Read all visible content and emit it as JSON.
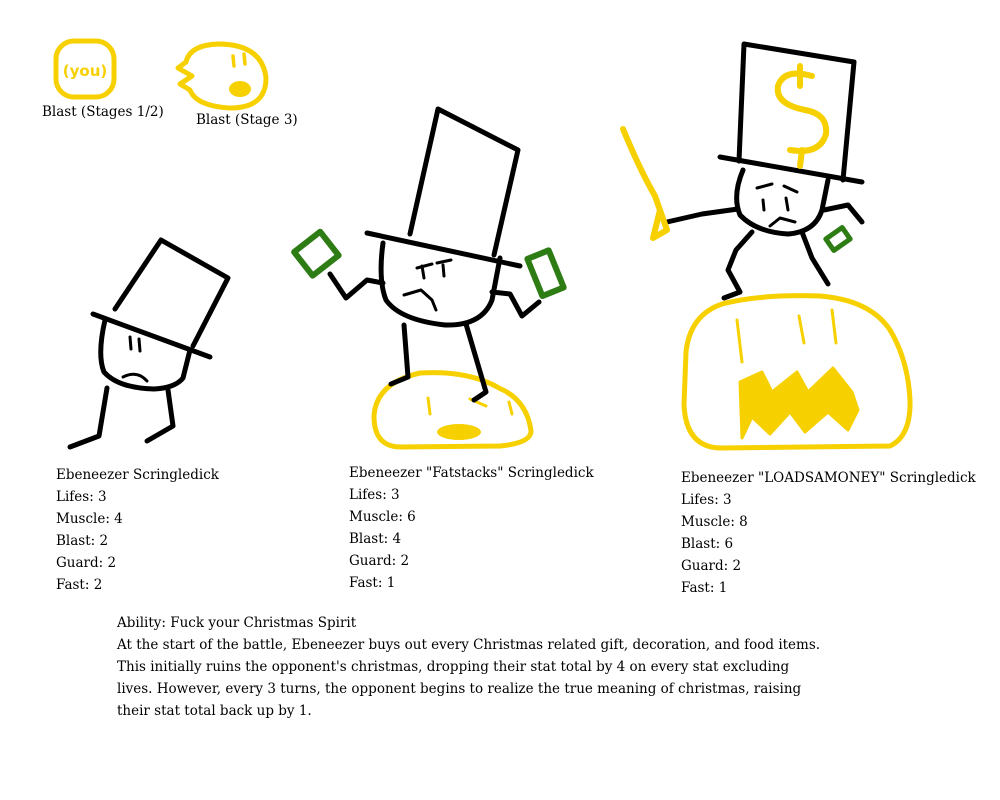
{
  "colors": {
    "ink": "#000000",
    "gold": "#f7d000",
    "cash": "#2e7d14",
    "background": "#ffffff"
  },
  "blast_icons": [
    {
      "icon": "you-blast-icon",
      "glyph": "(you)",
      "label": "Blast (Stages 1/2)"
    },
    {
      "icon": "face-blast-icon",
      "label": "Blast (Stage 3)"
    }
  ],
  "stages": [
    {
      "name": "Ebeneezer Scringledick",
      "stats": [
        "Lifes: 3",
        "Muscle: 4",
        "Blast: 2",
        "Guard: 2",
        "Fast: 2"
      ]
    },
    {
      "name": "Ebeneezer \"Fatstacks\" Scringledick",
      "stats": [
        "Lifes: 3",
        "Muscle: 6",
        "Blast: 4",
        "Guard: 2",
        "Fast: 1"
      ]
    },
    {
      "name": "Ebeneezer \"LOADSAMONEY\" Scringledick",
      "stats": [
        "Lifes: 3",
        "Muscle: 8",
        "Blast: 6",
        "Guard: 2",
        "Fast: 1"
      ]
    }
  ],
  "ability": {
    "title": "Ability: Fuck your Christmas Spirit",
    "lines": [
      "At the start of the battle, Ebeneezer buys out every Christmas related gift, decoration, and food items.",
      "This initially ruins the opponent's christmas, dropping their stat total by 4 on every stat excluding",
      "lives. However, every 3 turns, the opponent begins to realize the true meaning of christmas, raising",
      "their stat total back up by 1."
    ]
  }
}
